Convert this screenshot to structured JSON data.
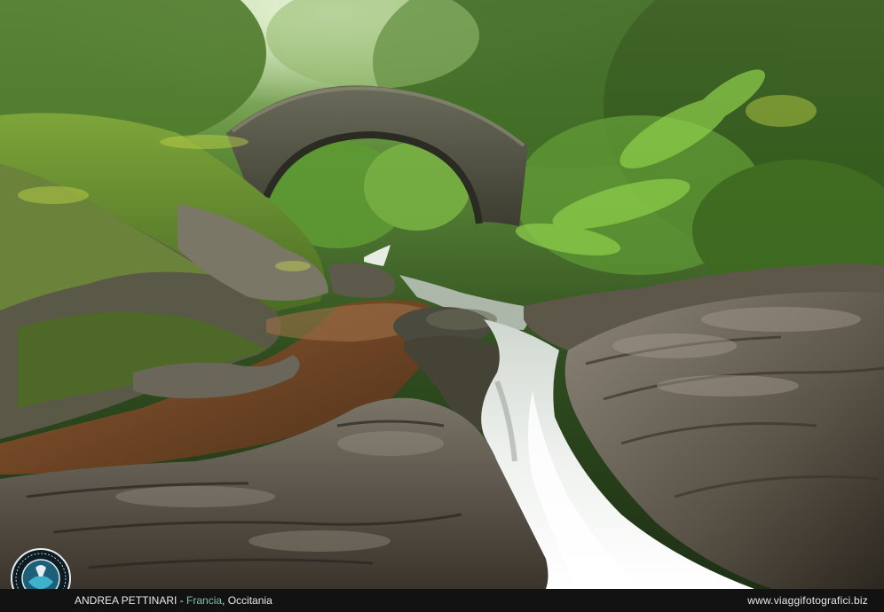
{
  "photo": {
    "subject": "stone-arch-bridge-waterfall-forest"
  },
  "footer": {
    "photographer": "ANDREA PETTINARI",
    "separator": " - ",
    "country": "Francia",
    "comma": ", ",
    "region": "Occitania",
    "website": "www.viaggifotografici.biz"
  },
  "logo": {
    "text": "VIAGGIFOTOGRAFICI.BIZ"
  },
  "colors": {
    "footer_bg": "#121212",
    "country_accent": "#7fc4a4"
  }
}
